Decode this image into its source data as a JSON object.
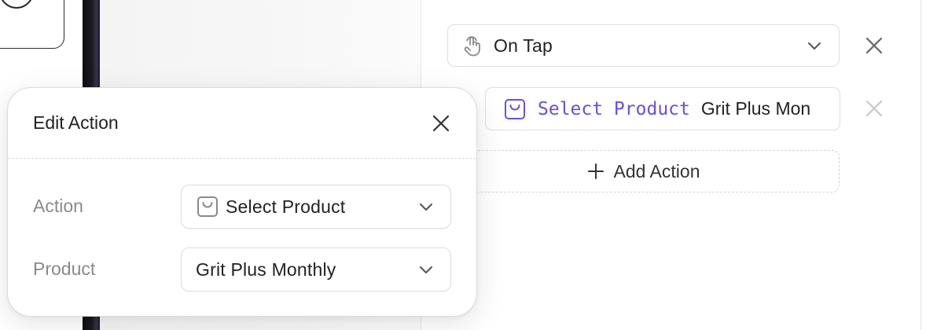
{
  "trigger": {
    "label": "On Tap",
    "icon": "tap-hand-icon"
  },
  "action_chip": {
    "kind": "Select Product",
    "value": "Grit Plus Mon",
    "accent": "#6b4fd8",
    "icon": "shopping-bag-icon"
  },
  "add_action": {
    "label": "Add Action"
  },
  "popover": {
    "title": "Edit Action",
    "fields": [
      {
        "label": "Action",
        "value": "Select Product",
        "icon": "shopping-bag-icon"
      },
      {
        "label": "Product",
        "value": "Grit Plus Monthly"
      }
    ]
  }
}
